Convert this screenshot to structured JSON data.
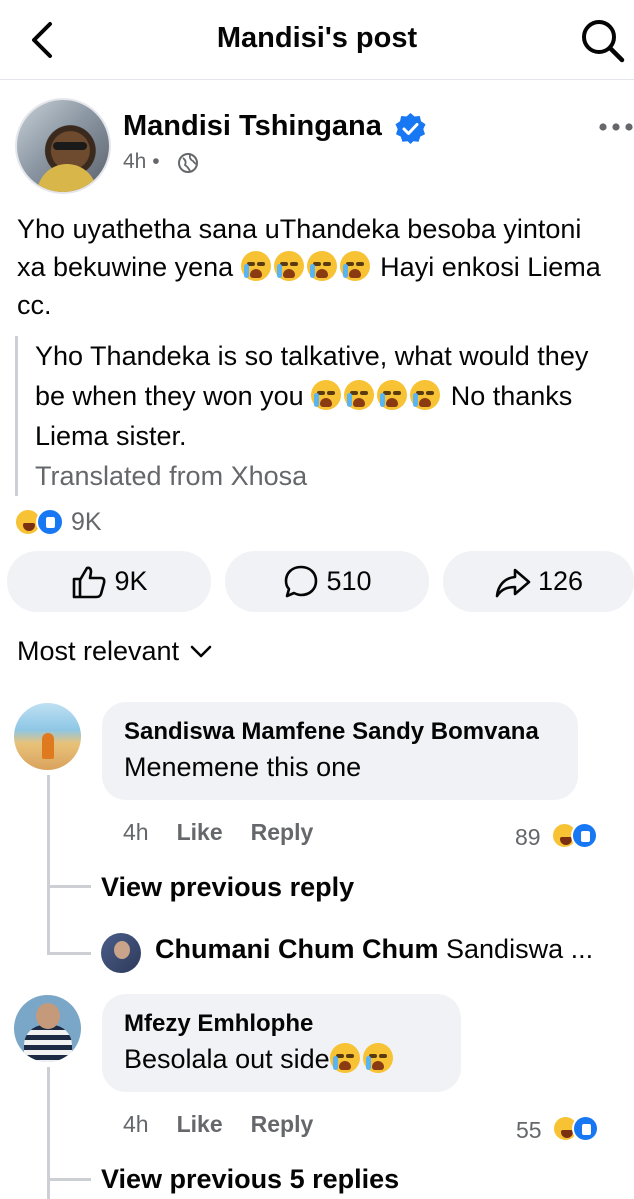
{
  "header": {
    "title": "Mandisi's post",
    "back_icon": "back-arrow-icon",
    "search_icon": "search-icon"
  },
  "post": {
    "author": "Mandisi Tshingana",
    "verified": true,
    "time": "4h",
    "separator": "•",
    "audience_icon": "globe-icon",
    "text_before": "Yho uyathetha sana uThandeka besoba yintoni xa bekuwine yena",
    "text_after": " Hayi enkosi Liema cc.",
    "translation_before": "Yho Thandeka is so talkative, what would they be when they won you",
    "translation_after": " No thanks Liema sister.",
    "translation_note": "Translated from Xhosa",
    "reactions_count": "9K",
    "reaction_icons": [
      "haha",
      "like"
    ],
    "actions": {
      "like": "9K",
      "comment": "510",
      "share": "126"
    },
    "accent_color": "#1877f2"
  },
  "comments_sort": "Most relevant",
  "comments": [
    {
      "name": "Sandiswa Mamfene Sandy Bomvana",
      "text": "Menemene this one",
      "time": "4h",
      "like_label": "Like",
      "reply_label": "Reply",
      "reactions": "89",
      "view_previous": "View previous reply",
      "latest_reply_author": "Chumani Chum Chum",
      "latest_reply_text": "Sandiswa ..."
    },
    {
      "name": "Mfezy Emhlophe",
      "text": "Besolala out side",
      "time": "4h",
      "like_label": "Like",
      "reply_label": "Reply",
      "reactions": "55",
      "view_previous": "View previous 5 replies"
    }
  ]
}
